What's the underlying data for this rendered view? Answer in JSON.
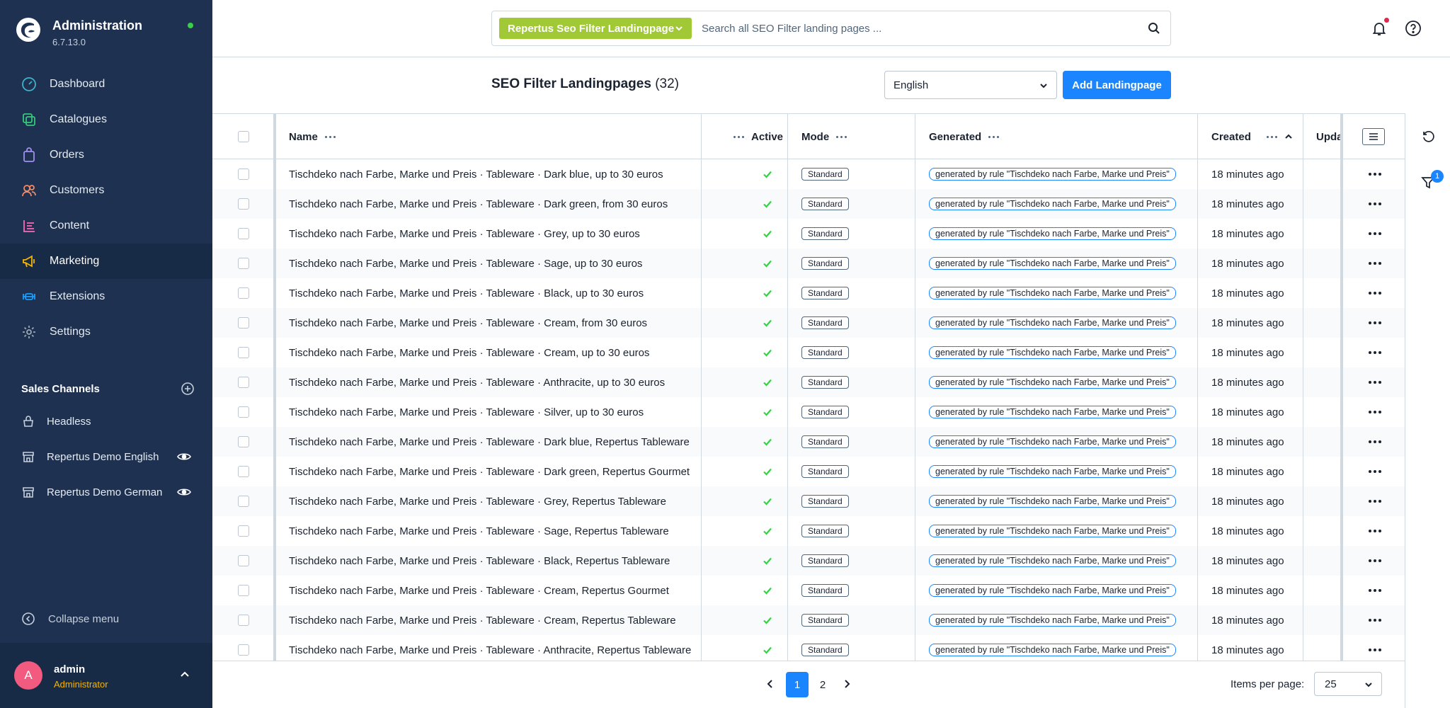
{
  "app": {
    "title": "Administration",
    "version": "6.7.13.0"
  },
  "nav": {
    "items": [
      {
        "label": "Dashboard",
        "icon": "dashboard-icon",
        "color": "#3fb1c9"
      },
      {
        "label": "Catalogues",
        "icon": "catalogues-icon",
        "color": "#35c97b"
      },
      {
        "label": "Orders",
        "icon": "orders-icon",
        "color": "#a18ff0"
      },
      {
        "label": "Customers",
        "icon": "customers-icon",
        "color": "#f88962"
      },
      {
        "label": "Content",
        "icon": "content-icon",
        "color": "#ff68b4"
      },
      {
        "label": "Marketing",
        "icon": "marketing-icon",
        "color": "#f7b500",
        "active": true
      },
      {
        "label": "Extensions",
        "icon": "extensions-icon",
        "color": "#189eff"
      },
      {
        "label": "Settings",
        "icon": "settings-icon",
        "color": "#9aa8b5"
      }
    ]
  },
  "sales_channels": {
    "title": "Sales Channels",
    "items": [
      {
        "label": "Headless",
        "icon": "headless-icon",
        "visible_icon": false
      },
      {
        "label": "Repertus Demo English",
        "icon": "storefront-icon",
        "visible_icon": true
      },
      {
        "label": "Repertus Demo German",
        "icon": "storefront-icon",
        "visible_icon": true
      }
    ]
  },
  "sidebar_footer": {
    "collapse_label": "Collapse menu",
    "user_initial": "A",
    "user_name": "admin",
    "user_role": "Administrator"
  },
  "search": {
    "type_label": "Repertus Seo Filter Landingpage",
    "placeholder": "Search all SEO Filter landing pages ..."
  },
  "page": {
    "title": "SEO Filter Landingpages",
    "count": "(32)",
    "language": "English",
    "add_button": "Add Landingpage"
  },
  "grid": {
    "columns": {
      "name": "Name",
      "active": "Active",
      "mode": "Mode",
      "generated": "Generated",
      "created": "Created",
      "updated": "Upda"
    },
    "rows": [
      {
        "name": "Tischdeko nach Farbe, Marke und Preis · Tableware · Dark blue, up to 30 euros",
        "mode": "Standard",
        "generated": "generated by rule \"Tischdeko nach Farbe, Marke und Preis\"",
        "created": "18 minutes ago"
      },
      {
        "name": "Tischdeko nach Farbe, Marke und Preis · Tableware · Dark green, from 30 euros",
        "mode": "Standard",
        "generated": "generated by rule \"Tischdeko nach Farbe, Marke und Preis\"",
        "created": "18 minutes ago"
      },
      {
        "name": "Tischdeko nach Farbe, Marke und Preis · Tableware · Grey, up to 30 euros",
        "mode": "Standard",
        "generated": "generated by rule \"Tischdeko nach Farbe, Marke und Preis\"",
        "created": "18 minutes ago"
      },
      {
        "name": "Tischdeko nach Farbe, Marke und Preis · Tableware · Sage, up to 30 euros",
        "mode": "Standard",
        "generated": "generated by rule \"Tischdeko nach Farbe, Marke und Preis\"",
        "created": "18 minutes ago"
      },
      {
        "name": "Tischdeko nach Farbe, Marke und Preis · Tableware · Black, up to 30 euros",
        "mode": "Standard",
        "generated": "generated by rule \"Tischdeko nach Farbe, Marke und Preis\"",
        "created": "18 minutes ago"
      },
      {
        "name": "Tischdeko nach Farbe, Marke und Preis · Tableware · Cream, from 30 euros",
        "mode": "Standard",
        "generated": "generated by rule \"Tischdeko nach Farbe, Marke und Preis\"",
        "created": "18 minutes ago"
      },
      {
        "name": "Tischdeko nach Farbe, Marke und Preis · Tableware · Cream, up to 30 euros",
        "mode": "Standard",
        "generated": "generated by rule \"Tischdeko nach Farbe, Marke und Preis\"",
        "created": "18 minutes ago"
      },
      {
        "name": "Tischdeko nach Farbe, Marke und Preis · Tableware · Anthracite, up to 30 euros",
        "mode": "Standard",
        "generated": "generated by rule \"Tischdeko nach Farbe, Marke und Preis\"",
        "created": "18 minutes ago"
      },
      {
        "name": "Tischdeko nach Farbe, Marke und Preis · Tableware · Silver, up to 30 euros",
        "mode": "Standard",
        "generated": "generated by rule \"Tischdeko nach Farbe, Marke und Preis\"",
        "created": "18 minutes ago"
      },
      {
        "name": "Tischdeko nach Farbe, Marke und Preis · Tableware · Dark blue, Repertus Tableware",
        "mode": "Standard",
        "generated": "generated by rule \"Tischdeko nach Farbe, Marke und Preis\"",
        "created": "18 minutes ago"
      },
      {
        "name": "Tischdeko nach Farbe, Marke und Preis · Tableware · Dark green, Repertus Gourmet",
        "mode": "Standard",
        "generated": "generated by rule \"Tischdeko nach Farbe, Marke und Preis\"",
        "created": "18 minutes ago"
      },
      {
        "name": "Tischdeko nach Farbe, Marke und Preis · Tableware · Grey, Repertus Tableware",
        "mode": "Standard",
        "generated": "generated by rule \"Tischdeko nach Farbe, Marke und Preis\"",
        "created": "18 minutes ago"
      },
      {
        "name": "Tischdeko nach Farbe, Marke und Preis · Tableware · Sage, Repertus Tableware",
        "mode": "Standard",
        "generated": "generated by rule \"Tischdeko nach Farbe, Marke und Preis\"",
        "created": "18 minutes ago"
      },
      {
        "name": "Tischdeko nach Farbe, Marke und Preis · Tableware · Black, Repertus Tableware",
        "mode": "Standard",
        "generated": "generated by rule \"Tischdeko nach Farbe, Marke und Preis\"",
        "created": "18 minutes ago"
      },
      {
        "name": "Tischdeko nach Farbe, Marke und Preis · Tableware · Cream, Repertus Gourmet",
        "mode": "Standard",
        "generated": "generated by rule \"Tischdeko nach Farbe, Marke und Preis\"",
        "created": "18 minutes ago"
      },
      {
        "name": "Tischdeko nach Farbe, Marke und Preis · Tableware · Cream, Repertus Tableware",
        "mode": "Standard",
        "generated": "generated by rule \"Tischdeko nach Farbe, Marke und Preis\"",
        "created": "18 minutes ago"
      },
      {
        "name": "Tischdeko nach Farbe, Marke und Preis · Tableware · Anthracite, Repertus Tableware",
        "mode": "Standard",
        "generated": "generated by rule \"Tischdeko nach Farbe, Marke und Preis\"",
        "created": "18 minutes ago"
      }
    ]
  },
  "filter_badge": "1",
  "pagination": {
    "pages": [
      "1",
      "2"
    ],
    "current": "1",
    "items_per_page_label": "Items per page:",
    "items_per_page": "25"
  },
  "colors": {
    "sidebar_bg": "#1e3150",
    "primary": "#1a85ff",
    "search_type_bg": "#a1c935",
    "success": "#37d046",
    "avatar": "#f25a80",
    "role": "#f7b500"
  }
}
